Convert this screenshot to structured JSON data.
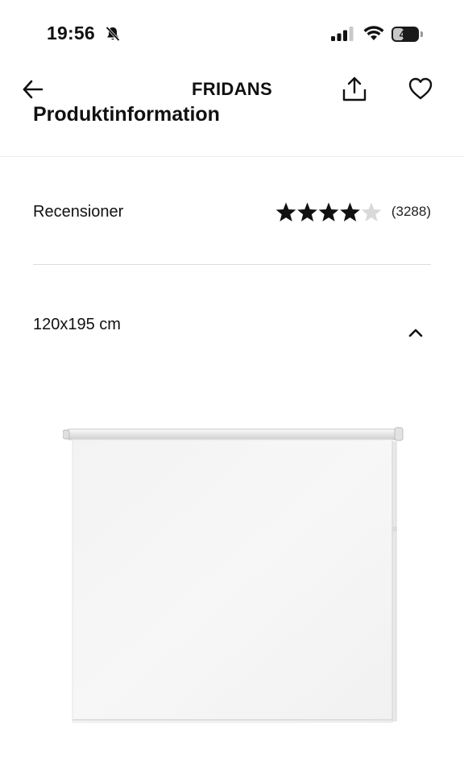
{
  "status_bar": {
    "time": "19:56",
    "battery": "43",
    "battery_level": 0.43,
    "icons": [
      "bell-off-icon",
      "signal-icon",
      "wifi-icon",
      "battery-icon"
    ]
  },
  "header": {
    "title": "FRIDANS",
    "section_heading": "Produktinformation",
    "icons": [
      "arrow-left-icon",
      "share-icon",
      "heart-icon"
    ]
  },
  "reviews": {
    "label": "Recensioner",
    "rating": 4,
    "max_rating": 5,
    "count": "(3288)"
  },
  "size": {
    "label": "120x195 cm",
    "icon": "chevron-up-icon"
  },
  "colors": {
    "text": "#111111",
    "divider": "#dcdcdc",
    "star_filled": "#111111",
    "star_empty": "#d9d9d9"
  }
}
